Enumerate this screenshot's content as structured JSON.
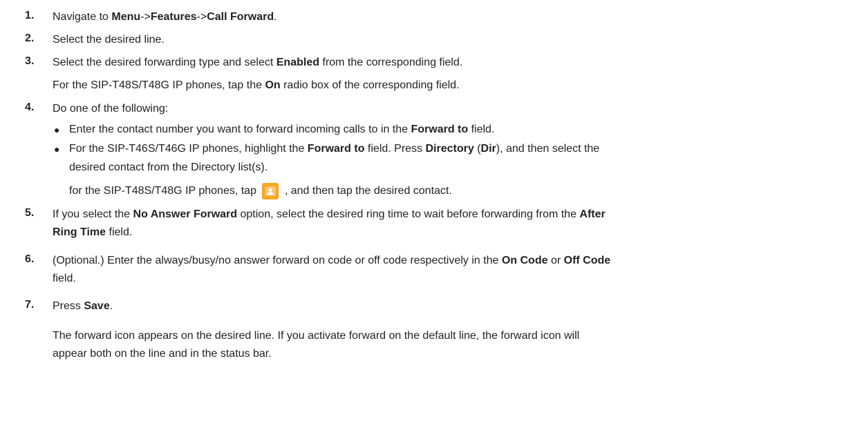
{
  "steps": [
    {
      "num": "1.",
      "parts": [
        "Navigate to ",
        "Menu",
        "->",
        "Features",
        "->",
        "Call Forward",
        "."
      ]
    },
    {
      "num": "2.",
      "text": "Select the desired line."
    },
    {
      "num": "3.",
      "parts": [
        "Select the desired forwarding type and select ",
        "Enabled",
        " from the corresponding field."
      ],
      "note_parts": [
        "For the SIP-T48S/T48G IP phones, tap the ",
        "On",
        " radio box of the corresponding field."
      ]
    },
    {
      "num": "4.",
      "text": "Do one of the following:",
      "bullets": [
        {
          "parts": [
            "Enter the contact number you want to forward incoming calls to in the ",
            "Forward to",
            " field."
          ]
        },
        {
          "parts": [
            "For the SIP-T46S/T46G IP phones, highlight the  ",
            "Forward to",
            " field. Press ",
            "Directory",
            " (",
            "Dir",
            "), and then select the"
          ],
          "cont": "desired contact from the Directory list(s)."
        }
      ],
      "after_icon_pre": "for the SIP-T48S/T48G IP phones, tap ",
      "after_icon_post": " , and then tap the desired contact.",
      "icon": "directory-contact-icon"
    },
    {
      "num": "5.",
      "parts": [
        "If you select the ",
        "No Answer Forward",
        " option, select the desired ring time to wait before forwarding from the ",
        "After"
      ],
      "cont_parts": [
        "Ring Time",
        " field."
      ]
    },
    {
      "num": "6.",
      "text": "(Optional.) Enter the always/busy/no answer forward on code or off code respectively in the ",
      "bold1": "On Code",
      "mid": " or ",
      "bold2": "Off Code",
      "cont": "field."
    },
    {
      "num": "7.",
      "parts": [
        "Press ",
        "Save",
        "."
      ],
      "note1": "The forward icon appears on the desired line. If you activate forward on the default line, the forward icon will",
      "note2": "appear both on the line and in the status bar."
    }
  ],
  "colors": {
    "icon_bg": "#f5a623",
    "text": "#222222"
  }
}
